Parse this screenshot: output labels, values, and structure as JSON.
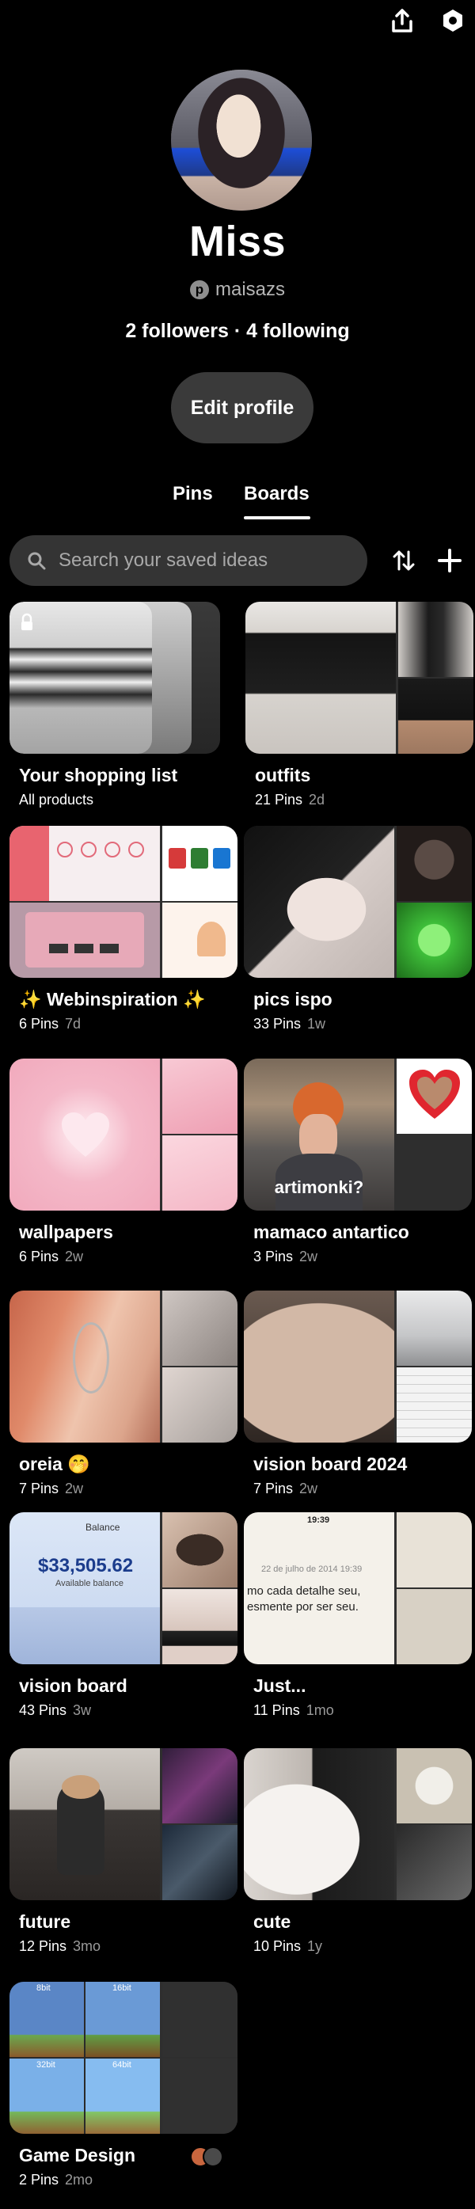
{
  "profile": {
    "name": "Miss",
    "username": "maisazs",
    "stats": "2 followers · 4 following",
    "edit_label": "Edit profile"
  },
  "tabs": {
    "pins": "Pins",
    "boards": "Boards",
    "active": "Boards"
  },
  "search": {
    "placeholder": "Search your saved ideas"
  },
  "icons": {
    "share": "share-icon",
    "settings": "settings-icon",
    "search": "search-icon",
    "sort": "sort-icon",
    "add": "plus-icon",
    "lock": "lock-icon",
    "pinterest": "pinterest-logo-icon"
  },
  "boards": [
    {
      "title": "Your shopping list",
      "meta": "All products",
      "age": ""
    },
    {
      "title": "outfits",
      "meta": "21 Pins",
      "age": "2d"
    },
    {
      "title": "✨ Webinspiration ✨",
      "meta": "6 Pins",
      "age": "7d"
    },
    {
      "title": "pics ispo",
      "meta": "33 Pins",
      "age": "1w"
    },
    {
      "title": "wallpapers",
      "meta": "6 Pins",
      "age": "2w"
    },
    {
      "title": "mamaco antartico",
      "meta": "3 Pins",
      "age": "2w",
      "overlay": "artimonki?"
    },
    {
      "title": "oreia 🤭",
      "meta": "7 Pins",
      "age": "2w"
    },
    {
      "title": "vision board 2024",
      "meta": "7 Pins",
      "age": "2w"
    },
    {
      "title": "vision board",
      "meta": "43 Pins",
      "age": "3w",
      "overlay_amount": "$33,505.62",
      "overlay_label": "Balance",
      "overlay_sub": "Available balance"
    },
    {
      "title": "Just...",
      "meta": "11 Pins",
      "age": "1mo",
      "overlay_time": "19:39",
      "overlay_date": "22 de julho de 2014 19:39",
      "overlay_text": "mo cada detalhe seu, esmente por ser seu."
    },
    {
      "title": "future",
      "meta": "12 Pins",
      "age": "3mo"
    },
    {
      "title": "cute",
      "meta": "10 Pins",
      "age": "1y"
    },
    {
      "title": "Game Design",
      "meta": "2 Pins",
      "age": "2mo",
      "tiles": [
        "8bit",
        "16bit",
        "32bit",
        "64bit"
      ]
    }
  ]
}
